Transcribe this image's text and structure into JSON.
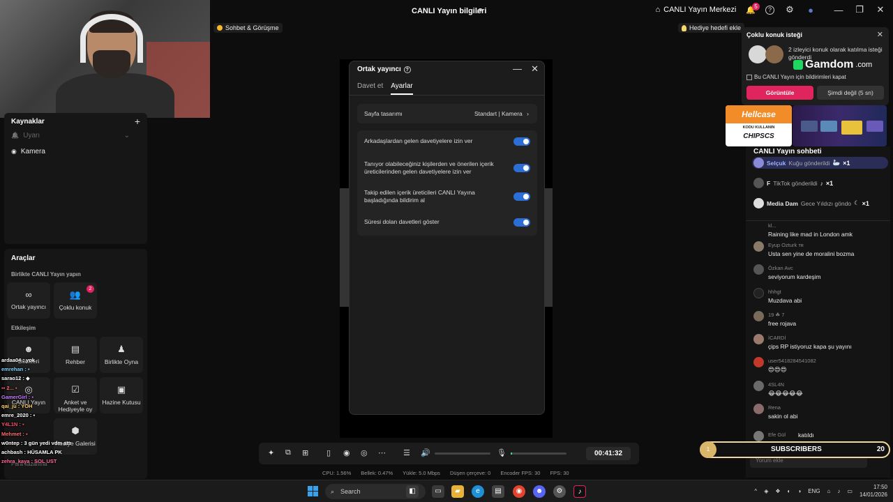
{
  "topbar": {
    "title": "CANLI Yayın bilgileri",
    "live_center": "CANLI Yayın Merkezi",
    "notif_count": "5",
    "share_icon": "↗",
    "live_center_icon": "⌂",
    "bell_icon": "🔔",
    "help_icon": "?",
    "settings_icon": "⚙",
    "globe_icon": "●",
    "min_icon": "—",
    "max_icon": "❐",
    "close_icon": "✕"
  },
  "pills": {
    "sohbet": "Sohbet & Görüşme",
    "hediye": "Hediye hedefi ekle"
  },
  "sources": {
    "title": "Kaynaklar",
    "plus": "+",
    "items": [
      {
        "label": "Uyarı",
        "icon": "🔔",
        "chev": "⌄"
      },
      {
        "label": "Kamera",
        "icon": "◉",
        "chev": ""
      }
    ]
  },
  "tools": {
    "title": "Araçlar",
    "section1": "Birlikte CANLI Yayın yapın",
    "section2": "Etkileşim",
    "tiles": [
      {
        "label": "Ortak yayıncı",
        "icon": "∞",
        "badge": ""
      },
      {
        "label": "Çoklu konuk",
        "icon": "👥",
        "badge": "2"
      },
      {
        "label": "Dilekleri",
        "icon": "☻",
        "badge": ""
      },
      {
        "label": "Rehber",
        "icon": "▤",
        "badge": ""
      },
      {
        "label": "Birlikte Oyna",
        "icon": "♟",
        "badge": ""
      },
      {
        "label": "CANLI Yayın",
        "icon": "◎",
        "badge": ""
      },
      {
        "label": "Anket ve Hediyeyle oy",
        "icon": "☑",
        "badge": ""
      },
      {
        "label": "Hazine Kutusu",
        "icon": "▣",
        "badge": ""
      },
      {
        "label": "Hediye Galerisi",
        "icon": "⬢",
        "badge": ""
      }
    ],
    "bottom_label": "Para kazanma"
  },
  "overlay_chat": [
    {
      "text": "ardaa04 : yok",
      "color": "#ffffff"
    },
    {
      "text": "emrehan : ▪",
      "color": "#7fd3ff"
    },
    {
      "text": "sarao12 : ◆",
      "color": "#ffffff"
    },
    {
      "text": "▪▪ 2... ▪",
      "color": "#ff6b6b"
    },
    {
      "text": "GamerGirl : ▪",
      "color": "#c77dff"
    },
    {
      "text": "qai_ju : YOH",
      "color": "#ffd166"
    },
    {
      "text": "emre_2020 : ▪",
      "color": "#ffffff"
    },
    {
      "text": "Y4L1N : ▪",
      "color": "#ff4d6d"
    },
    {
      "text": "Mehmet : ▪",
      "color": "#ff6b6b"
    },
    {
      "text": "w0ntep : 3 gün yedi vdm attı",
      "color": "#ffffff"
    },
    {
      "text": "achbash : HÜSAMLA PK",
      "color": "#ffffff"
    },
    {
      "text": "zehra_kaya : SOL UST",
      "color": "#ff6b9d"
    }
  ],
  "dialog": {
    "title": "Ortak yayıncı",
    "help_icon": "?",
    "min_icon": "—",
    "close_icon": "✕",
    "tabs": [
      "Davet et",
      "Ayarlar"
    ],
    "layout_label": "Sayfa tasarımı",
    "layout_value": "Standart | Kamera",
    "chevron": "›",
    "settings": [
      "Arkadaşlardan gelen davetiyelere izin ver",
      "Tanıyor olabileceğiniz kişilerden ve önerilen içerik üreticilerinden gelen davetiyelere izin ver",
      "Takip edilen içerik üreticileri CANLI Yayına başladığında bildirim al",
      "Süresi dolan davetleri göster"
    ]
  },
  "controls": {
    "icons": [
      "✦",
      "⧉",
      "⊞",
      "▯",
      "◉",
      "◎",
      "⋯",
      "☰",
      "🔊",
      "🎙"
    ],
    "timer": "00:41:32"
  },
  "stats": [
    "CPU: 1.56%",
    "Bellek: 0.47%",
    "Yükle: 5.0 Mbps",
    "Düşen çerçeve: 0",
    "Encoder FPS: 30",
    "FPS: 30"
  ],
  "popup": {
    "title": "Çoklu konuk isteği",
    "close": "✕",
    "text": "2 izleyici konuk olarak katılma isteği gönderdi",
    "checkbox": "Bu CANLI Yayın için bildirimleri kapat",
    "btn_view": "Görüntüle",
    "btn_later": "Şimdi değil (5 sn)"
  },
  "gamdom": {
    "name": "Gamdom",
    "suffix": ".com"
  },
  "hellcase": {
    "brand": "Hellcase",
    "sub": "KODU KULLANIN",
    "code": "CHIPSCS"
  },
  "chat": {
    "title": "CANLI Yayın sohbeti",
    "gifts": [
      {
        "user": "Selçuk",
        "action": "Kuğu gönderildi",
        "count": "×1",
        "icon": "🦢",
        "highlight": true
      },
      {
        "user": "F",
        "action": "TikTok gönderildi",
        "count": "×1",
        "icon": "♪",
        "highlight": false
      },
      {
        "user": "Media Dam",
        "action": "Gece Yıldızı göndo",
        "count": "×1",
        "icon": "☾",
        "highlight": false
      }
    ],
    "messages": [
      {
        "user": "kl...",
        "text": "Raining like mad in London amk",
        "color": "#6b6b6b"
      },
      {
        "user": "Eyup Ozturk ᴛʀ",
        "text": "Usta sen yine de moralini bozma",
        "color": "#8a7a6a"
      },
      {
        "user": "Özkan Avc",
        "text": "seviyorum kardeşim",
        "color": "#555555"
      },
      {
        "user": "hhhgt",
        "text": "Muzdava abi",
        "color": "#222222"
      },
      {
        "user": "19 ☘ 7",
        "text": "free rojava",
        "color": "#7a6a5a"
      },
      {
        "user": "İCARDİ",
        "text": "çips RP istiyoruz kapa şu yayını",
        "color": "#9a7a6a"
      },
      {
        "user": "user5418284541082",
        "text": "😍😍😍",
        "color": "#c0392b"
      },
      {
        "user": "4SL4N",
        "text": "😂😂😂😂😂",
        "color": "#6a6a6a"
      },
      {
        "user": "Rena",
        "text": "sakin ol abi",
        "color": "#8a6a6a"
      },
      {
        "user": "Efe Gül",
        "text": "katıldı",
        "color": "#777777"
      }
    ],
    "comment_placeholder": "Yorum ekle"
  },
  "subs": {
    "count_left": "1",
    "label": "SUBSCRIBERS",
    "count": "20"
  },
  "taskbar": {
    "search": "Search",
    "search_icon": "⌕",
    "lang": "ENG",
    "time": "17:50",
    "date": "14/01/2026",
    "apps": [
      "◧",
      "▭",
      "▰",
      "e",
      "▤",
      "◉",
      "☻",
      "⚙",
      "♪"
    ],
    "tray_icons": [
      "^",
      "◈",
      "❖",
      "◐",
      "◑",
      "⌂",
      "♪",
      "▭"
    ]
  },
  "colors": {
    "accent": "#e0245e",
    "toggle": "#2b6fd6",
    "panel": "#1c1c1c"
  }
}
